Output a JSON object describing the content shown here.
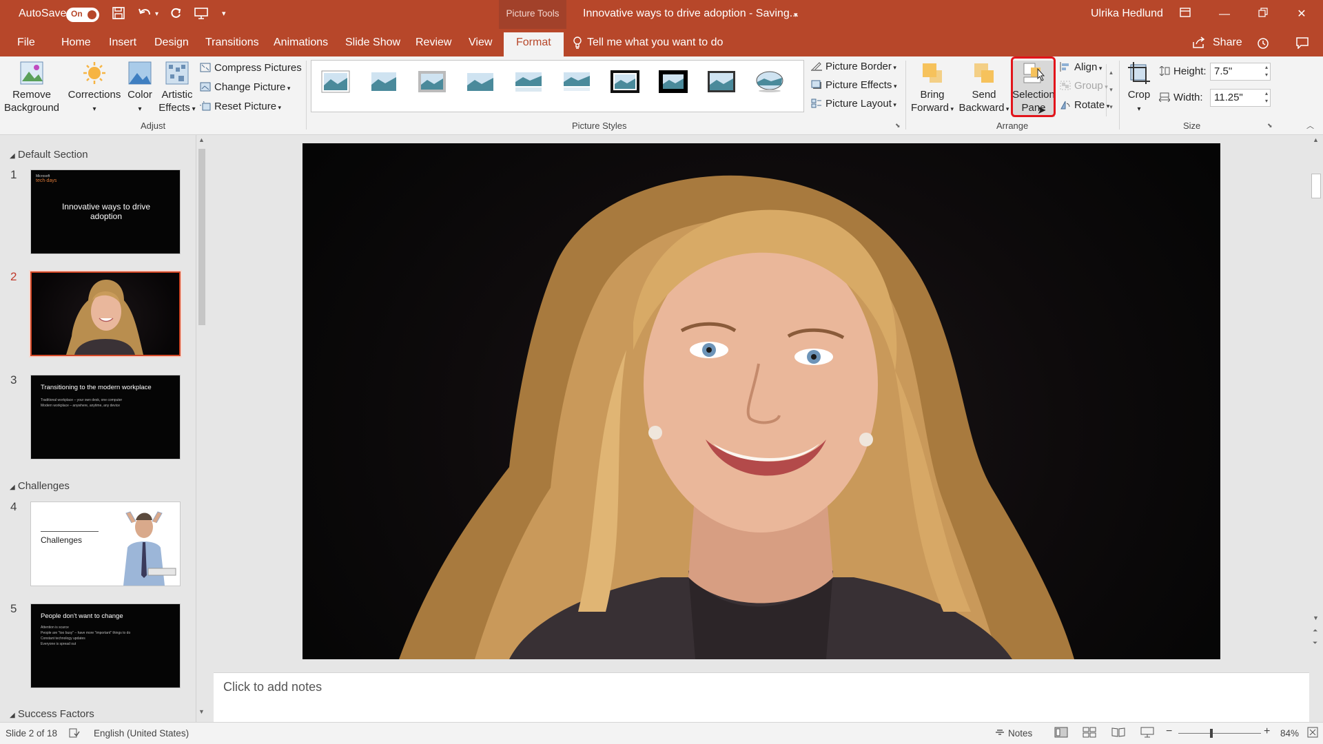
{
  "titlebar": {
    "autosave_label": "AutoSave",
    "autosave_state": "On",
    "context_tab": "Picture Tools",
    "doc_title": "Innovative ways to drive adoption  -  Saving...",
    "user": "Ulrika Hedlund"
  },
  "tabs": [
    "File",
    "Home",
    "Insert",
    "Design",
    "Transitions",
    "Animations",
    "Slide Show",
    "Review",
    "View",
    "Format"
  ],
  "active_tab": "Format",
  "tellme": "Tell me what you want to do",
  "share": "Share",
  "ribbon": {
    "adjust": {
      "remove_bg_1": "Remove",
      "remove_bg_2": "Background",
      "corrections": "Corrections",
      "color": "Color",
      "artistic_1": "Artistic",
      "artistic_2": "Effects",
      "compress": "Compress Pictures",
      "change": "Change Picture",
      "reset": "Reset Picture",
      "label": "Adjust"
    },
    "styles": {
      "border": "Picture Border",
      "effects": "Picture Effects",
      "layout": "Picture Layout",
      "label": "Picture Styles"
    },
    "arrange": {
      "bring_1": "Bring",
      "bring_2": "Forward",
      "send_1": "Send",
      "send_2": "Backward",
      "selection_1": "Selection",
      "selection_2": "Pane",
      "align": "Align",
      "group": "Group",
      "rotate": "Rotate",
      "label": "Arrange"
    },
    "size": {
      "crop": "Crop",
      "height_label": "Height:",
      "height_value": "7.5\"",
      "width_label": "Width:",
      "width_value": "11.25\"",
      "label": "Size"
    }
  },
  "slides_panel": {
    "sections": [
      "Default Section",
      "Challenges",
      "Success Factors"
    ],
    "slides": [
      {
        "num": "1",
        "brand_1": "Microsoft",
        "brand_2": "tech·days",
        "title": "Innovative ways to drive adoption"
      },
      {
        "num": "2"
      },
      {
        "num": "3",
        "title": "Transitioning to the modern workplace",
        "bullets": [
          "Traditional workplace – your own desk, one computer",
          "Modern workplace – anywhere, anytime, any device"
        ]
      },
      {
        "num": "4",
        "title": "Challenges"
      },
      {
        "num": "5",
        "title": "People don't want to change",
        "bullets": [
          "Attention is scarce",
          "People are \"too busy\" – have more \"important\" things to do",
          "Constant technology updates",
          "Everyone is spread out"
        ]
      }
    ]
  },
  "notes_placeholder": "Click to add notes",
  "status": {
    "slide_info": "Slide 2 of 18",
    "language": "English (United States)",
    "notes": "Notes",
    "zoom": "84%"
  },
  "colors": {
    "accent": "#b7472a",
    "highlight": "#e2141b"
  }
}
